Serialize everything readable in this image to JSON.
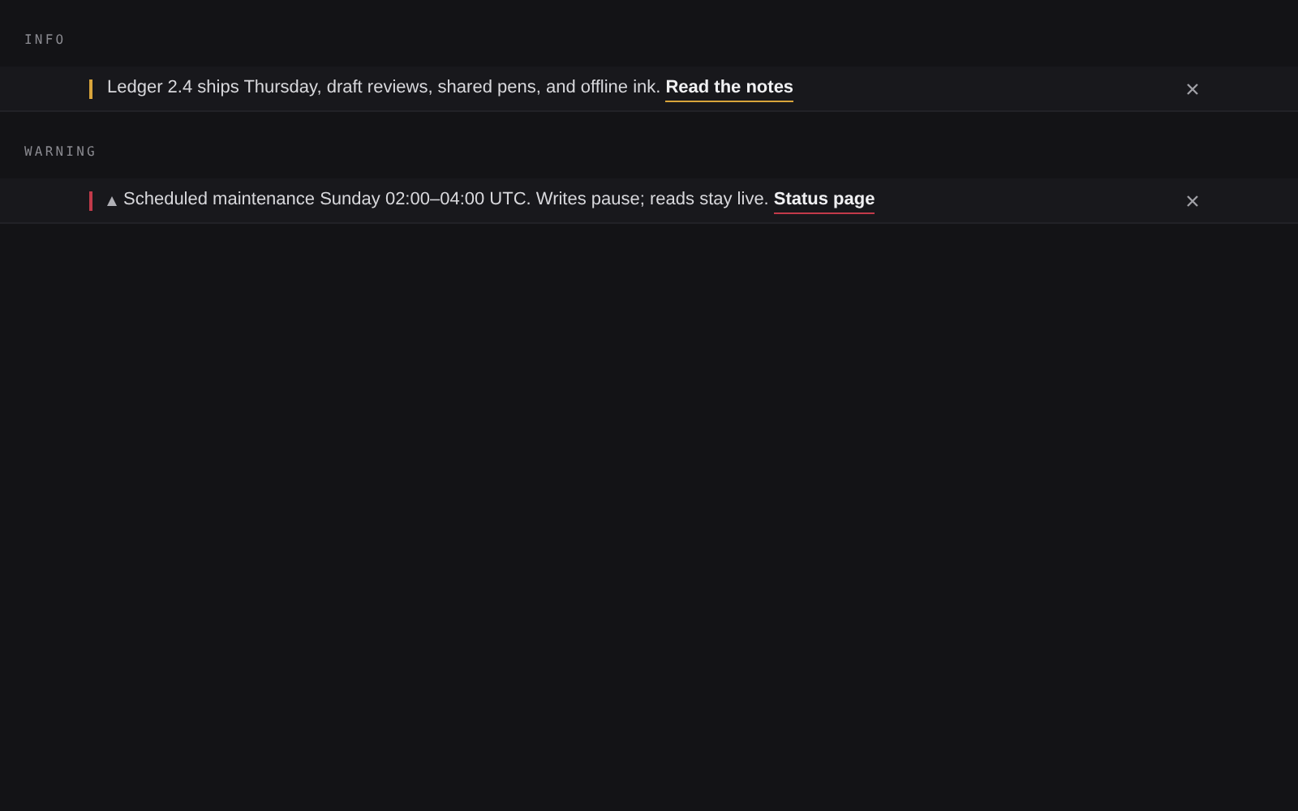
{
  "sections": [
    {
      "label": "INFO",
      "banner": {
        "kind": "info",
        "color": "#d9a53b",
        "message": "Ledger 2.4 ships Thursday, draft reviews, shared pens, and offline ink.",
        "link": "Read the notes"
      }
    },
    {
      "label": "WARNING",
      "banner": {
        "kind": "warning",
        "color": "#c23a4a",
        "message": "Scheduled maintenance Sunday 02:00–04:00 UTC. Writes pause; reads stay live.",
        "link": "Status page"
      }
    }
  ]
}
